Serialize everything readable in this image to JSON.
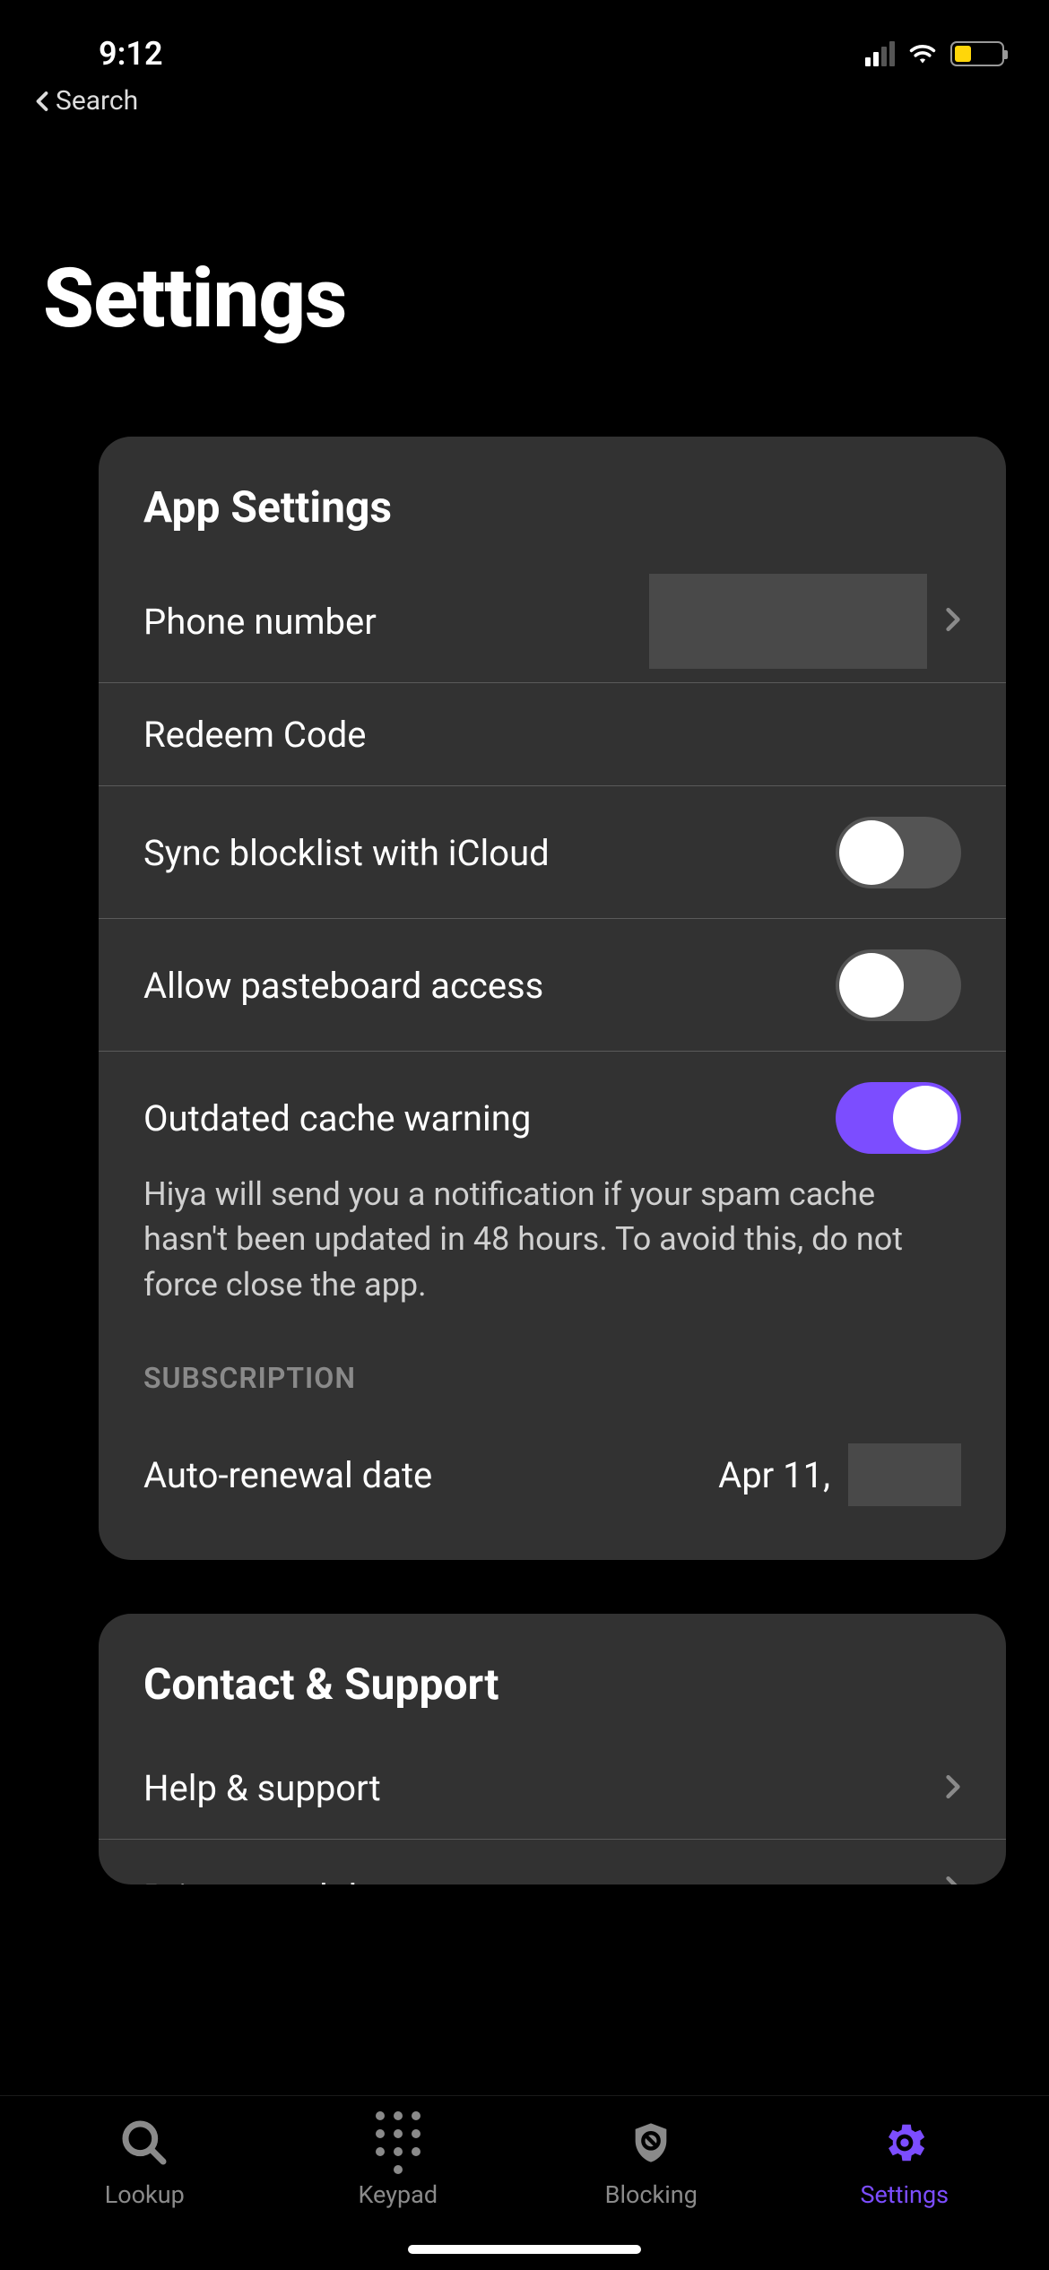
{
  "status": {
    "time": "9:12",
    "back_label": "Search"
  },
  "page": {
    "title": "Settings"
  },
  "app_settings": {
    "title": "App Settings",
    "phone_label": "Phone number",
    "redeem_label": "Redeem Code",
    "sync_label": "Sync blocklist with iCloud",
    "sync_on": false,
    "pasteboard_label": "Allow pasteboard access",
    "pasteboard_on": false,
    "cache_label": "Outdated cache warning",
    "cache_on": true,
    "cache_desc": "Hiya will send you a notification if your spam cache hasn't been updated in 48 hours. To avoid this, do not force close the app.",
    "subscription_header": "SUBSCRIPTION",
    "renewal_label": "Auto-renewal date",
    "renewal_value": "Apr 11,"
  },
  "contact": {
    "title": "Contact & Support",
    "help_label": "Help & support",
    "privacy_label": "Privacy and data"
  },
  "tabs": {
    "lookup": "Lookup",
    "keypad": "Keypad",
    "blocking": "Blocking",
    "settings": "Settings"
  },
  "colors": {
    "accent": "#7c4dff",
    "card_bg": "#323232",
    "text_secondary": "#8a8a8a"
  }
}
